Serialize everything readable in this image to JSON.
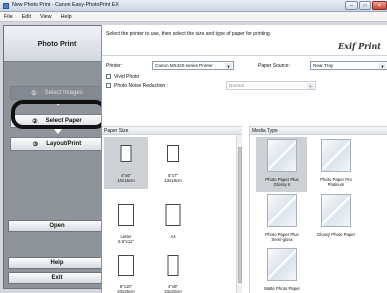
{
  "window": {
    "title": "New Photo Print - Canon Easy-PhotoPrint EX",
    "buttons": [
      "–",
      "□",
      "×"
    ]
  },
  "menu": [
    "File",
    "Edit",
    "View",
    "Help"
  ],
  "sidebar": {
    "header": "Photo Print",
    "steps": [
      {
        "num": "①",
        "label": "Select Images"
      },
      {
        "num": "②",
        "label": "Select Paper"
      },
      {
        "num": "③",
        "label": "Layout/Print"
      }
    ],
    "open": "Open",
    "help": "Help",
    "exit": "Exit"
  },
  "main": {
    "instruction": "Select the printer to use, then select the size and type of paper for printing.",
    "logo": "Exif Print",
    "printer_label": "Printer:",
    "printer_value": "Canon MX420 series Printer",
    "source_label": "Paper Source:",
    "source_value": "Rear Tray",
    "vivid_label": "Vivid Photo",
    "noise_label": "Photo Noise Reduction :",
    "noise_value": "Normal",
    "paper_size_title": "Paper Size",
    "media_type_title": "Media Type",
    "paper_sizes": [
      {
        "label": "4\"x6\"\n10x15cm"
      },
      {
        "label": "5\"x7\"\n13x18cm"
      },
      {
        "label": "Letter\n8.5\"x11\""
      },
      {
        "label": "A4"
      },
      {
        "label": "8\"x10\"\n20x25cm"
      },
      {
        "label": "4\"x8\"\n10x20cm"
      }
    ],
    "media_types": [
      {
        "label": "Photo Paper Plus\nGlossy II"
      },
      {
        "label": "Photo Paper Pro\nPlatinum"
      },
      {
        "label": "Photo Paper Plus\nSemi-gloss"
      },
      {
        "label": "Glossy Photo Paper"
      },
      {
        "label": "Matte Photo Paper"
      }
    ]
  }
}
